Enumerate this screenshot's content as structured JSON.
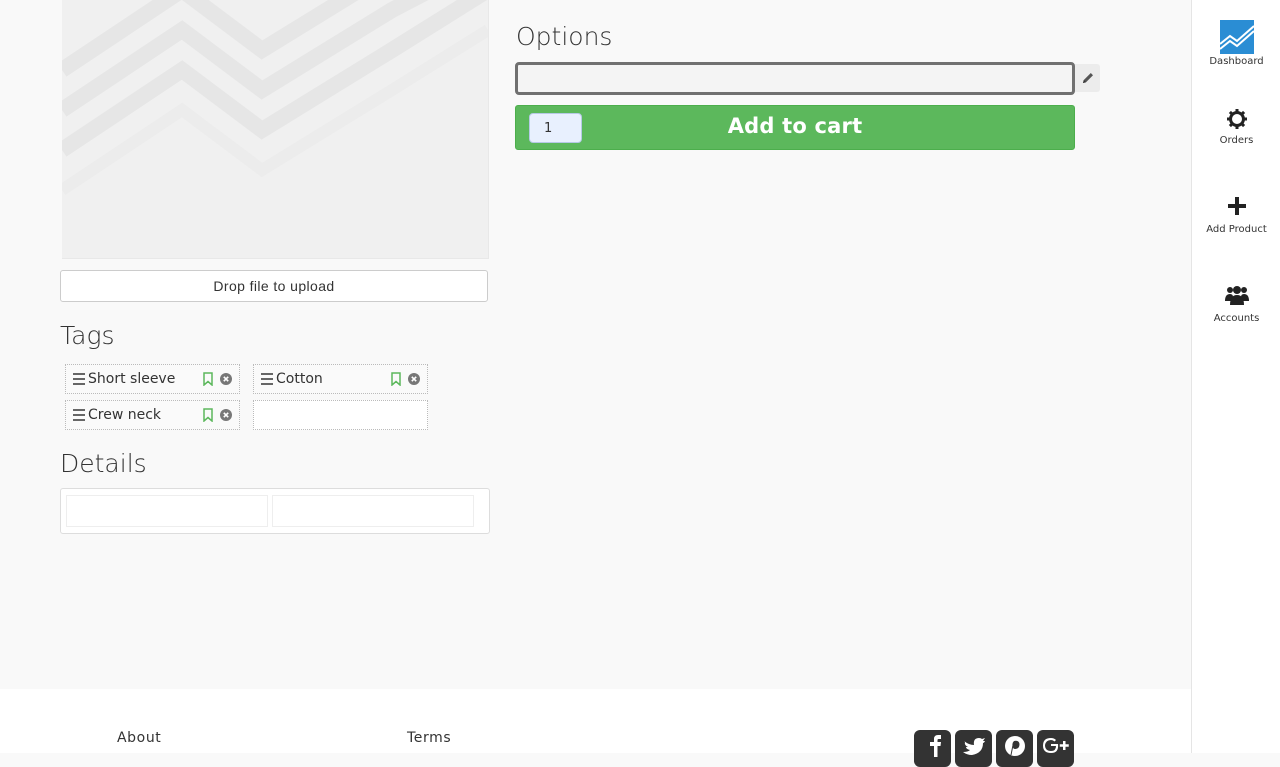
{
  "product": {
    "upload_label": "Drop file to upload"
  },
  "tags": {
    "heading": "Tags",
    "items": [
      {
        "label": "Short sleeve"
      },
      {
        "label": "Cotton"
      },
      {
        "label": "Crew neck"
      }
    ],
    "new_tag_value": ""
  },
  "details": {
    "heading": "Details",
    "field_1": "",
    "field_2": ""
  },
  "options": {
    "heading": "Options",
    "value": "",
    "quantity": "1",
    "add_to_cart_label": "Add to cart"
  },
  "sidebar": {
    "items": [
      {
        "label": "Dashboard",
        "icon": "dashboard-logo-icon"
      },
      {
        "label": "Orders",
        "icon": "gear-icon"
      },
      {
        "label": "Add Product",
        "icon": "plus-icon"
      },
      {
        "label": "Accounts",
        "icon": "users-icon"
      }
    ]
  },
  "footer": {
    "links": [
      "About",
      "Terms"
    ],
    "social": [
      "facebook-icon",
      "twitter-icon",
      "pinterest-icon",
      "google-plus-icon"
    ]
  },
  "colors": {
    "accent_green": "#5cb85c",
    "tag_bookmark_green": "#5cb85c",
    "dashboard_blue": "#2a8dd4"
  }
}
